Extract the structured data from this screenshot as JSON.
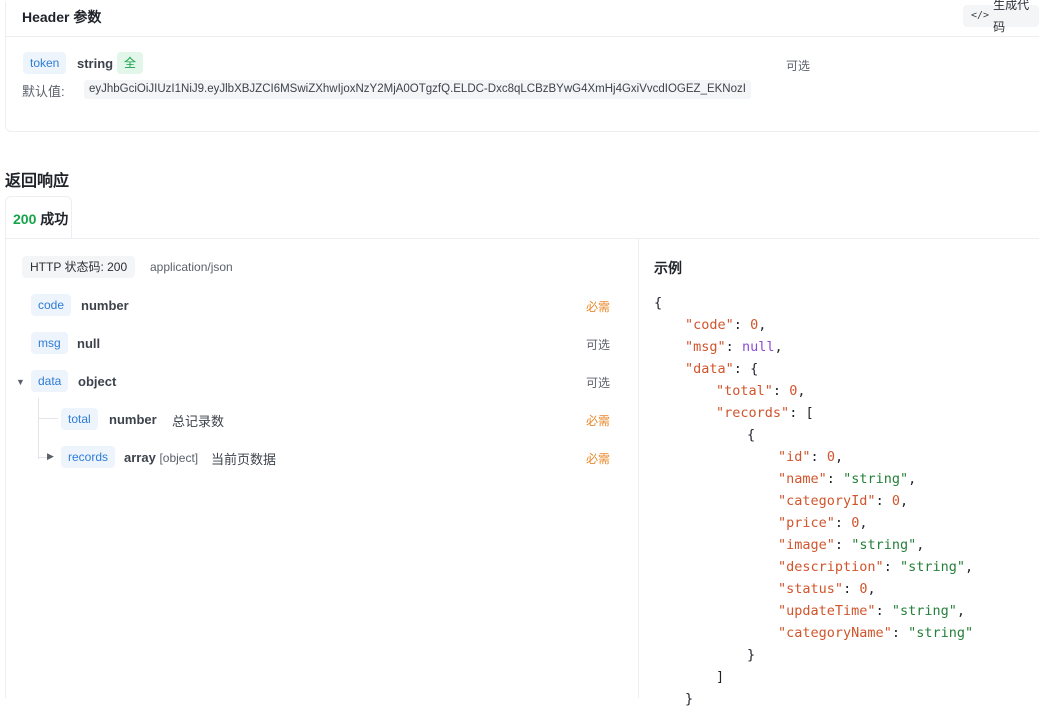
{
  "header_params": {
    "title": "Header 参数",
    "generate_code_label": "生成代码",
    "param": {
      "name": "token",
      "type": "string",
      "badge": "全",
      "required_label": "可选",
      "default_label": "默认值:",
      "default_value": "eyJhbGciOiJIUzI1NiJ9.eyJlbXBJZCI6MSwiZXhwIjoxNzY2MjA0OTgzfQ.ELDC-Dxc8qLCBzBYwG4XmHj4GxiVvcdIOGEZ_EKNozI"
    }
  },
  "response": {
    "title": "返回响应",
    "tab": {
      "code": "200",
      "label": "成功"
    },
    "http_status": "HTTP 状态码: 200",
    "content_type": "application/json",
    "fields": [
      {
        "name": "code",
        "type": "number",
        "required": "必需"
      },
      {
        "name": "msg",
        "type": "null",
        "required": "可选"
      },
      {
        "name": "data",
        "type": "object",
        "required": "可选"
      },
      {
        "name": "total",
        "type": "number",
        "desc": "总记录数",
        "required": "必需"
      },
      {
        "name": "records",
        "type": "array",
        "type_extra": "[object]",
        "desc": "当前页数据",
        "required": "必需"
      }
    ]
  },
  "example": {
    "title": "示例",
    "lines": [
      {
        "indent": 0,
        "text": "{"
      },
      {
        "indent": 1,
        "key": "code",
        "val": "0",
        "vt": "n",
        "tail": ","
      },
      {
        "indent": 1,
        "key": "msg",
        "val": "null",
        "vt": "nl",
        "tail": ","
      },
      {
        "indent": 1,
        "key": "data",
        "val": "",
        "vt": "",
        "tail": "{"
      },
      {
        "indent": 2,
        "key": "total",
        "val": "0",
        "vt": "n",
        "tail": ","
      },
      {
        "indent": 2,
        "key": "records",
        "val": "",
        "vt": "",
        "tail": "["
      },
      {
        "indent": 3,
        "text": "{"
      },
      {
        "indent": 4,
        "key": "id",
        "val": "0",
        "vt": "n",
        "tail": ","
      },
      {
        "indent": 4,
        "key": "name",
        "val": "\"string\"",
        "vt": "s",
        "tail": ","
      },
      {
        "indent": 4,
        "key": "categoryId",
        "val": "0",
        "vt": "n",
        "tail": ","
      },
      {
        "indent": 4,
        "key": "price",
        "val": "0",
        "vt": "n",
        "tail": ","
      },
      {
        "indent": 4,
        "key": "image",
        "val": "\"string\"",
        "vt": "s",
        "tail": ","
      },
      {
        "indent": 4,
        "key": "description",
        "val": "\"string\"",
        "vt": "s",
        "tail": ","
      },
      {
        "indent": 4,
        "key": "status",
        "val": "0",
        "vt": "n",
        "tail": ","
      },
      {
        "indent": 4,
        "key": "updateTime",
        "val": "\"string\"",
        "vt": "s",
        "tail": ","
      },
      {
        "indent": 4,
        "key": "categoryName",
        "val": "\"string\"",
        "vt": "s",
        "tail": ""
      },
      {
        "indent": 3,
        "text": "}"
      },
      {
        "indent": 2,
        "text": "]"
      },
      {
        "indent": 1,
        "text": "}"
      }
    ]
  }
}
